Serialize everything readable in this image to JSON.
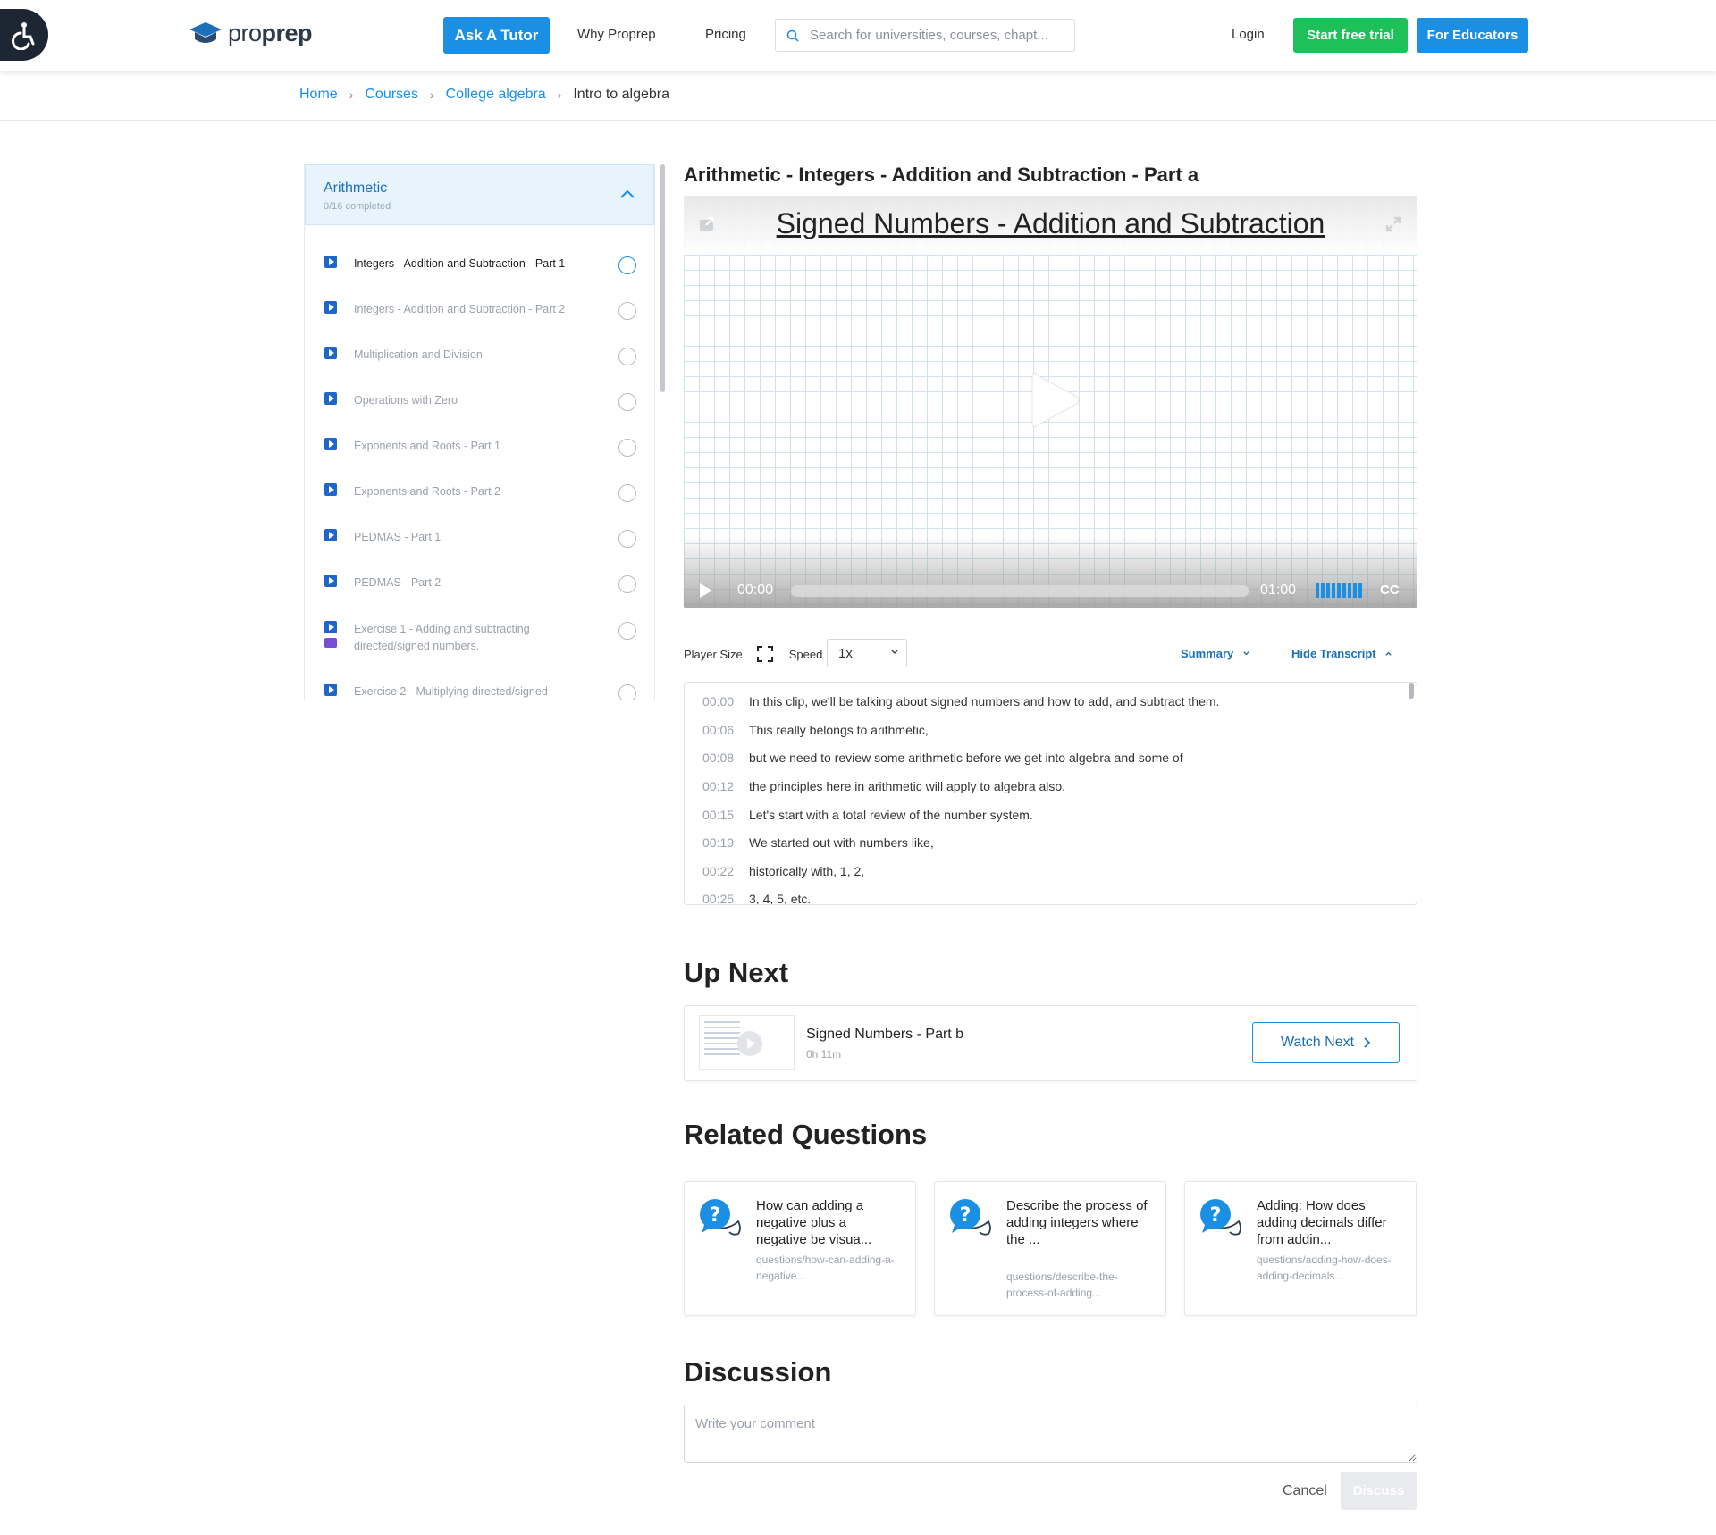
{
  "header": {
    "logo": {
      "text_light": "pro",
      "text_bold": "prep"
    },
    "ask_tutor": "Ask A Tutor",
    "nav": [
      "Why Proprep",
      "Pricing"
    ],
    "search_placeholder": "Search for universities, courses, chapt...",
    "login": "Login",
    "start_trial": "Start free trial",
    "for_educators": "For Educators"
  },
  "breadcrumb": [
    {
      "label": "Home",
      "link": true
    },
    {
      "label": "Courses",
      "link": true
    },
    {
      "label": "College algebra",
      "link": true
    },
    {
      "label": "Intro to algebra",
      "link": false
    }
  ],
  "sidebar": {
    "title": "Arithmetic",
    "subtitle": "0/16 completed",
    "lessons": [
      {
        "label": "Integers - Addition and Subtraction - Part 1",
        "active": true
      },
      {
        "label": "Integers - Addition and Subtraction - Part 2",
        "active": false
      },
      {
        "label": "Multiplication and Division",
        "active": false
      },
      {
        "label": "Operations with Zero",
        "active": false
      },
      {
        "label": "Exponents and Roots - Part 1",
        "active": false
      },
      {
        "label": "Exponents and Roots - Part 2",
        "active": false
      },
      {
        "label": "PEDMAS - Part 1",
        "active": false
      },
      {
        "label": "PEDMAS - Part 2",
        "active": false
      },
      {
        "label": "Exercise 1 - Adding and subtracting directed/signed numbers.",
        "active": false
      },
      {
        "label": "Exercise 2 - Multiplying directed/signed",
        "active": false
      }
    ]
  },
  "video": {
    "page_title": "Arithmetic - Integers - Addition and Subtraction - Part a",
    "heading": "Signed Numbers - Addition and Subtraction",
    "current_time": "00:00",
    "duration": "01:00",
    "cc": "CC",
    "progress": 0
  },
  "player_options": {
    "player_size_label": "Player Size",
    "speed_label": "Speed",
    "speed_value": "1x",
    "summary": "Summary",
    "hide_transcript": "Hide Transcript"
  },
  "transcript": [
    {
      "time": "00:00",
      "text": "In this clip, we'll be talking about signed numbers and how to add, and subtract them."
    },
    {
      "time": "00:06",
      "text": "This really belongs to arithmetic,"
    },
    {
      "time": "00:08",
      "text": "but we need to review some arithmetic before we get into algebra and some of"
    },
    {
      "time": "00:12",
      "text": "the principles here in arithmetic will apply to algebra also."
    },
    {
      "time": "00:15",
      "text": "Let's start with a total review of the number system."
    },
    {
      "time": "00:19",
      "text": "We started out with numbers like,"
    },
    {
      "time": "00:22",
      "text": "historically with, 1, 2,"
    },
    {
      "time": "00:25",
      "text": "3, 4, 5, etc."
    }
  ],
  "up_next": {
    "heading": "Up Next",
    "title": "Signed Numbers - Part b",
    "duration": "0h 11m",
    "watch_next": "Watch Next"
  },
  "related": {
    "heading": "Related Questions",
    "questions": [
      {
        "title": "How can adding a negative plus a negative be visua...",
        "url": "questions/how-can-adding-a-negative..."
      },
      {
        "title": "Describe the process of adding integers where the ...",
        "url": "questions/describe-the-process-of-adding..."
      },
      {
        "title": "Adding: How does adding decimals differ from addin...",
        "url": "questions/adding-how-does-adding-decimals..."
      }
    ]
  },
  "discussion": {
    "heading": "Discussion",
    "placeholder": "Write your comment",
    "cancel": "Cancel",
    "submit": "Discuss"
  },
  "colors": {
    "brand_blue": "#1a8fe3",
    "trial_green": "#1ec05a",
    "lesson_icon": "#1f66c9"
  }
}
